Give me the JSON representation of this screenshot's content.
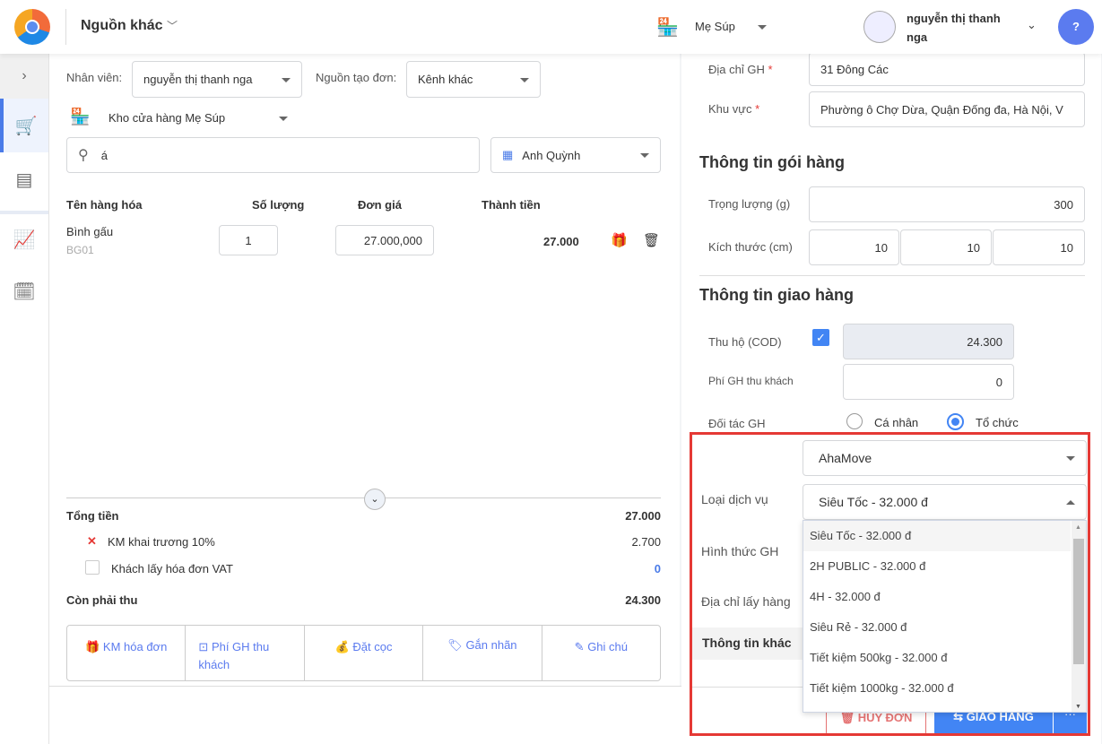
{
  "header": {
    "source": "Nguồn khác",
    "store": "Mẹ Súp",
    "user": "nguyễn thị thanh nga"
  },
  "order": {
    "staff_label": "Nhân viên:",
    "staff": "nguyễn thị thanh nga",
    "source_label": "Nguồn tạo đơn:",
    "source": "Kênh khác",
    "warehouse": "Kho cửa hàng Mẹ Súp",
    "search_value": "á",
    "price_list": "Anh Quỳnh"
  },
  "table": {
    "headers": [
      "Tên hàng hóa",
      "Số lượng",
      "Đơn giá",
      "Thành tiền"
    ],
    "rows": [
      {
        "name": "Bình gấu",
        "code": "BG01",
        "qty": "1",
        "price": "27.000,000",
        "total": "27.000"
      }
    ]
  },
  "summary": {
    "total_label": "Tổng tiền",
    "total": "27.000",
    "promo_label": "KM khai trương 10%",
    "promo": "2.700",
    "vat_label": "Khách lấy hóa đơn VAT",
    "vat": "0",
    "due_label": "Còn phải thu",
    "due": "24.300"
  },
  "actions": [
    "KM hóa đơn",
    "Phí GH thu khách",
    "Đặt cọc",
    "Gắn nhãn",
    "Ghi chú"
  ],
  "shipping": {
    "address_label": "Địa chỉ GH",
    "address": "31 Đông Các",
    "area_label": "Khu vực",
    "area": "Phường ô Chợ Dừa, Quận Đống đa, Hà Nội, V",
    "package_title": "Thông tin gói hàng",
    "weight_label": "Trọng lượng (g)",
    "weight": "300",
    "size_label": "Kích thước (cm)",
    "size": [
      "10",
      "10",
      "10"
    ],
    "delivery_title": "Thông tin giao hàng",
    "cod_label": "Thu hộ (COD)",
    "cod": "24.300",
    "fee_label": "Phí GH thu khách",
    "fee": "0",
    "partner_label": "Đối tác GH",
    "partner_options": [
      "Cá nhân",
      "Tổ chức"
    ],
    "partner": "AhaMove",
    "service_label": "Loại dịch vụ",
    "service": "Siêu Tốc - 32.000 đ",
    "method_label": "Hình thức GH",
    "pickup_label": "Địa chỉ lấy hàng",
    "other_title": "Thông tin khác",
    "service_options": [
      "Siêu Tốc - 32.000 đ",
      "2H PUBLIC - 32.000 đ",
      "4H - 32.000 đ",
      "Siêu Rẻ - 32.000 đ",
      "Tiết kiệm 500kg - 32.000 đ",
      "Tiết kiệm 1000kg - 32.000 đ"
    ]
  },
  "footer": {
    "cancel": "HỦY ĐƠN",
    "deliver": "GIAO HÀNG"
  },
  "colors": {
    "accent": "#4285f4",
    "highlight": "#e53935"
  }
}
